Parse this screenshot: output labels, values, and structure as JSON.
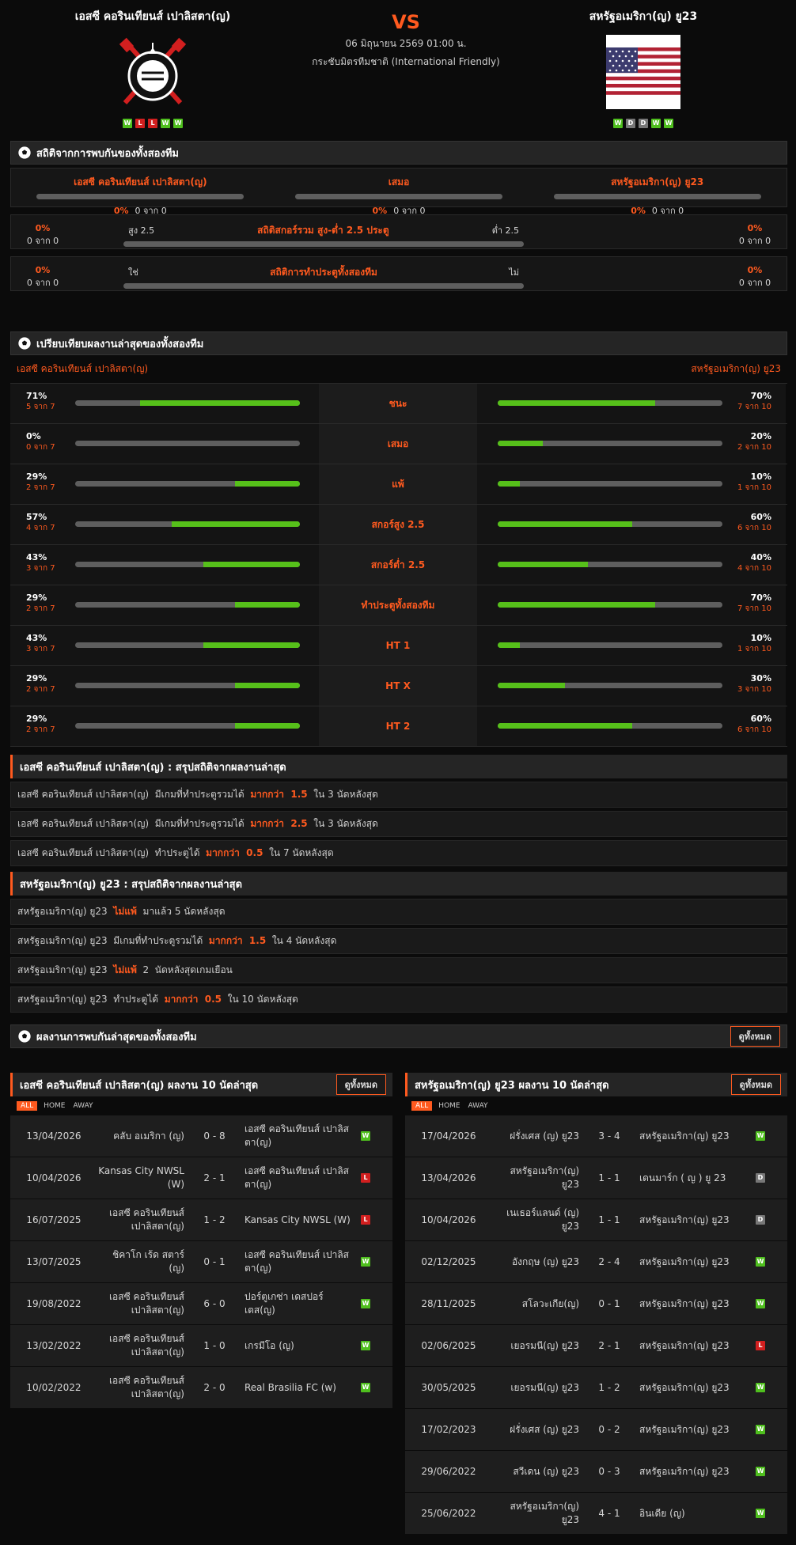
{
  "header": {
    "home_name": "เอสซี คอรินเทียนส์ เปาลิสตา(ญ)",
    "away_name": "สหรัฐอเมริกา(ญ) ยู23",
    "vs": "VS",
    "datetime": "06 มิถุนายน 2569 01:00 น.",
    "competition": "กระชับมิตรทีมชาติ (International Friendly)",
    "home_form": [
      "W",
      "L",
      "L",
      "W",
      "W"
    ],
    "away_form": [
      "W",
      "D",
      "D",
      "W",
      "W"
    ],
    "colors": {
      "accent": "#ff5a1f",
      "win": "#4fbf1e",
      "loss": "#d21f1f",
      "draw": "#777777"
    }
  },
  "h2h": {
    "title": "สถิติจากการพบกันของทั้งสองทีม",
    "home": {
      "label": "เอสซี คอรินเทียนส์ เปาลิสตา(ญ)",
      "pct": "0%",
      "count": "0 จาก 0",
      "value": 0
    },
    "draw": {
      "label": "เสมอ",
      "pct": "0%",
      "count": "0 จาก 0",
      "value": 0
    },
    "away": {
      "label": "สหรัฐอเมริกา(ญ) ยู23",
      "pct": "0%",
      "count": "0 จาก 0",
      "value": 0
    },
    "over_under": {
      "title": "สถิติสกอร์รวม สูง-ต่ำ 2.5 ประตู",
      "left_label": "สูง 2.5",
      "right_label": "ต่ำ 2.5",
      "left_pct": "0%",
      "left_count": "0 จาก 0",
      "right_pct": "0%",
      "right_count": "0 จาก 0"
    },
    "btts": {
      "title": "สถิติการทำประตูทั้งสองทีม",
      "left_label": "ใช่",
      "right_label": "ไม่",
      "left_pct": "0%",
      "left_count": "0 จาก 0",
      "right_pct": "0%",
      "right_count": "0 จาก 0"
    }
  },
  "compare": {
    "title": "เปรียบเทียบผลงานล่าสุดของทั้งสองทีม",
    "home_name": "เอสซี คอรินเทียนส์ เปาลิสตา(ญ)",
    "away_name": "สหรัฐอเมริกา(ญ) ยู23",
    "rows": [
      {
        "label": "ชนะ",
        "home_pct": "71%",
        "home_count": "5 จาก 7",
        "home_value": 71,
        "away_pct": "70%",
        "away_count": "7 จาก 10",
        "away_value": 70
      },
      {
        "label": "เสมอ",
        "home_pct": "0%",
        "home_count": "0 จาก 7",
        "home_value": 0,
        "away_pct": "20%",
        "away_count": "2 จาก 10",
        "away_value": 20
      },
      {
        "label": "แพ้",
        "home_pct": "29%",
        "home_count": "2 จาก 7",
        "home_value": 29,
        "away_pct": "10%",
        "away_count": "1 จาก 10",
        "away_value": 10
      },
      {
        "label": "สกอร์สูง 2.5",
        "home_pct": "57%",
        "home_count": "4 จาก 7",
        "home_value": 57,
        "away_pct": "60%",
        "away_count": "6 จาก 10",
        "away_value": 60
      },
      {
        "label": "สกอร์ต่ำ 2.5",
        "home_pct": "43%",
        "home_count": "3 จาก 7",
        "home_value": 43,
        "away_pct": "40%",
        "away_count": "4 จาก 10",
        "away_value": 40
      },
      {
        "label": "ทำประตูทั้งสองทีม",
        "home_pct": "29%",
        "home_count": "2 จาก 7",
        "home_value": 29,
        "away_pct": "70%",
        "away_count": "7 จาก 10",
        "away_value": 70
      },
      {
        "label": "HT 1",
        "home_pct": "43%",
        "home_count": "3 จาก 7",
        "home_value": 43,
        "away_pct": "10%",
        "away_count": "1 จาก 10",
        "away_value": 10
      },
      {
        "label": "HT X",
        "home_pct": "29%",
        "home_count": "2 จาก 7",
        "home_value": 29,
        "away_pct": "30%",
        "away_count": "3 จาก 10",
        "away_value": 30
      },
      {
        "label": "HT 2",
        "home_pct": "29%",
        "home_count": "2 จาก 7",
        "home_value": 29,
        "away_pct": "60%",
        "away_count": "6 จาก 10",
        "away_value": 60
      }
    ]
  },
  "summary_home": {
    "title": "เอสซี คอรินเทียนส์ เปาลิสตา(ญ) : สรุปสถิติจากผลงานล่าสุด",
    "rows": [
      {
        "pre": "เอสซี คอรินเทียนส์ เปาลิสตา(ญ)  มีเกมที่ทำประตูรวมได้  ",
        "hl": "มากกว่า  1.5",
        "post": "  ใน 3 นัดหลังสุด"
      },
      {
        "pre": "เอสซี คอรินเทียนส์ เปาลิสตา(ญ)  มีเกมที่ทำประตูรวมได้  ",
        "hl": "มากกว่า  2.5",
        "post": "  ใน 3 นัดหลังสุด"
      },
      {
        "pre": "เอสซี คอรินเทียนส์ เปาลิสตา(ญ)  ทำประตูได้  ",
        "hl": "มากกว่า  0.5",
        "post": "  ใน 7 นัดหลังสุด"
      }
    ]
  },
  "summary_away": {
    "title": "สหรัฐอเมริกา(ญ) ยู23 : สรุปสถิติจากผลงานล่าสุด",
    "rows": [
      {
        "pre": "สหรัฐอเมริกา(ญ) ยู23  ",
        "hl": "ไม่แพ้",
        "post": "  มาแล้ว 5 นัดหลังสุด"
      },
      {
        "pre": "สหรัฐอเมริกา(ญ) ยู23  มีเกมที่ทำประตูรวมได้  ",
        "hl": "มากกว่า  1.5",
        "post": "  ใน 4 นัดหลังสุด"
      },
      {
        "pre": "สหรัฐอเมริกา(ญ) ยู23  ",
        "hl": "ไม่แพ้",
        "post": "  2  นัดหลังสุดเกมเยือน"
      },
      {
        "pre": "สหรัฐอเมริกา(ญ) ยู23  ทำประตูได้  ",
        "hl": "มากกว่า  0.5",
        "post": "  ใน 10 นัดหลังสุด"
      }
    ]
  },
  "recent": {
    "title": "ผลงานการพบกันล่าสุดของทั้งสองทีม",
    "view_all": "ดูทั้งหมด",
    "filters": [
      "ALL",
      "HOME",
      "AWAY"
    ],
    "home": {
      "title": "เอสซี คอรินเทียนส์ เปาลิสตา(ญ) ผลงาน 10 นัดล่าสุด",
      "matches": [
        {
          "date": "13/04/2026",
          "home": "คลับ อเมริกา (ญ)",
          "score": "0 - 8",
          "away": "เอสซี คอรินเทียนส์ เปาลิสตา(ญ)",
          "result": "W"
        },
        {
          "date": "10/04/2026",
          "home": "Kansas City NWSL (W)",
          "score": "2 - 1",
          "away": "เอสซี คอรินเทียนส์ เปาลิสตา(ญ)",
          "result": "L"
        },
        {
          "date": "16/07/2025",
          "home": "เอสซี คอรินเทียนส์ เปาลิสตา(ญ)",
          "score": "1 - 2",
          "away": "Kansas City NWSL (W)",
          "result": "L"
        },
        {
          "date": "13/07/2025",
          "home": "ชิคาโก เร้ด สตาร์ (ญ)",
          "score": "0 - 1",
          "away": "เอสซี คอรินเทียนส์ เปาลิสตา(ญ)",
          "result": "W"
        },
        {
          "date": "19/08/2022",
          "home": "เอสซี คอรินเทียนส์ เปาลิสตา(ญ)",
          "score": "6 - 0",
          "away": "ปอร์ตูเกซ่า เดสปอร์เตส(ญ)",
          "result": "W"
        },
        {
          "date": "13/02/2022",
          "home": "เอสซี คอรินเทียนส์ เปาลิสตา(ญ)",
          "score": "1 - 0",
          "away": "เกรมีโอ (ญ)",
          "result": "W"
        },
        {
          "date": "10/02/2022",
          "home": "เอสซี คอรินเทียนส์ เปาลิสตา(ญ)",
          "score": "2 - 0",
          "away": "Real Brasilia FC (w)",
          "result": "W"
        }
      ]
    },
    "away": {
      "title": "สหรัฐอเมริกา(ญ) ยู23 ผลงาน 10 นัดล่าสุด",
      "matches": [
        {
          "date": "17/04/2026",
          "home": "ฝรั่งเศส (ญ) ยู23",
          "score": "3 - 4",
          "away": "สหรัฐอเมริกา(ญ) ยู23",
          "result": "W"
        },
        {
          "date": "13/04/2026",
          "home": "สหรัฐอเมริกา(ญ) ยู23",
          "score": "1 - 1",
          "away": "เดนมาร์ก ( ญ ) ยู 23",
          "result": "D"
        },
        {
          "date": "10/04/2026",
          "home": "เนเธอร์แลนด์ (ญ) ยู23",
          "score": "1 - 1",
          "away": "สหรัฐอเมริกา(ญ) ยู23",
          "result": "D"
        },
        {
          "date": "02/12/2025",
          "home": "อังกฤษ (ญ) ยู23",
          "score": "2 - 4",
          "away": "สหรัฐอเมริกา(ญ) ยู23",
          "result": "W"
        },
        {
          "date": "28/11/2025",
          "home": "สโลวะเกีย(ญ)",
          "score": "0 - 1",
          "away": "สหรัฐอเมริกา(ญ) ยู23",
          "result": "W"
        },
        {
          "date": "02/06/2025",
          "home": "เยอรมนี(ญ) ยู23",
          "score": "2 - 1",
          "away": "สหรัฐอเมริกา(ญ) ยู23",
          "result": "L"
        },
        {
          "date": "30/05/2025",
          "home": "เยอรมนี(ญ) ยู23",
          "score": "1 - 2",
          "away": "สหรัฐอเมริกา(ญ) ยู23",
          "result": "W"
        },
        {
          "date": "17/02/2023",
          "home": "ฝรั่งเศส (ญ) ยู23",
          "score": "0 - 2",
          "away": "สหรัฐอเมริกา(ญ) ยู23",
          "result": "W"
        },
        {
          "date": "29/06/2022",
          "home": "สวีเดน (ญ) ยู23",
          "score": "0 - 3",
          "away": "สหรัฐอเมริกา(ญ) ยู23",
          "result": "W"
        },
        {
          "date": "25/06/2022",
          "home": "สหรัฐอเมริกา(ญ) ยู23",
          "score": "4 - 1",
          "away": "อินเดีย (ญ)",
          "result": "W"
        }
      ]
    }
  }
}
